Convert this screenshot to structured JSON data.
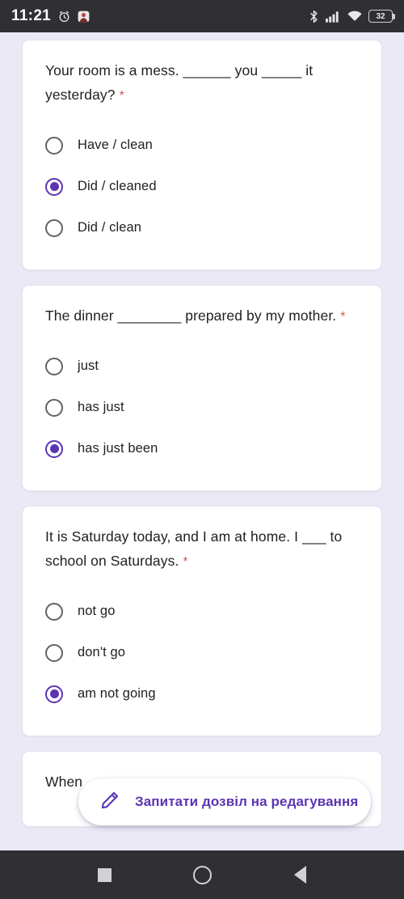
{
  "status_bar": {
    "time": "11:21",
    "alarm_icon": "alarm-clock-icon",
    "notification_icon": "app-notification-icon",
    "bluetooth_icon": "bluetooth-icon",
    "signal_icon": "cellular-signal-icon",
    "wifi_icon": "wifi-icon",
    "battery_level": "32"
  },
  "form": {
    "questions": [
      {
        "text": "Your room is a mess. ______ you _____ it yesterday?",
        "required_marker": "*",
        "options": [
          {
            "label": "Have / clean",
            "selected": false
          },
          {
            "label": "Did / cleaned",
            "selected": true
          },
          {
            "label": "Did / clean",
            "selected": false
          }
        ]
      },
      {
        "text": "The dinner ________ prepared by my mother.",
        "required_marker": "*",
        "options": [
          {
            "label": "just",
            "selected": false
          },
          {
            "label": "has just",
            "selected": false
          },
          {
            "label": "has just been",
            "selected": true
          }
        ]
      },
      {
        "text": "It is Saturday today, and I am at home. I ___ to school on Saturdays.",
        "required_marker": "*",
        "options": [
          {
            "label": "not go",
            "selected": false
          },
          {
            "label": "don't go",
            "selected": false
          },
          {
            "label": "am not going",
            "selected": true
          }
        ]
      },
      {
        "text": "When",
        "required_marker": "",
        "comment_badge": "!",
        "options": []
      }
    ]
  },
  "request_access": {
    "icon": "pencil-edit-icon",
    "label": "Запитати дозвіл на редагування",
    "accent_color": "#5b34b3"
  },
  "nav_bar": {
    "recents": "recents-square-icon",
    "home": "home-circle-icon",
    "back": "back-triangle-icon"
  },
  "colors": {
    "page_background": "#ece9f6",
    "card_background": "#ffffff",
    "accent_purple": "#5b34b3",
    "required_red": "#cf5b56",
    "text_primary": "#202124",
    "radio_outline": "#5f6368",
    "system_bar": "#303034"
  }
}
